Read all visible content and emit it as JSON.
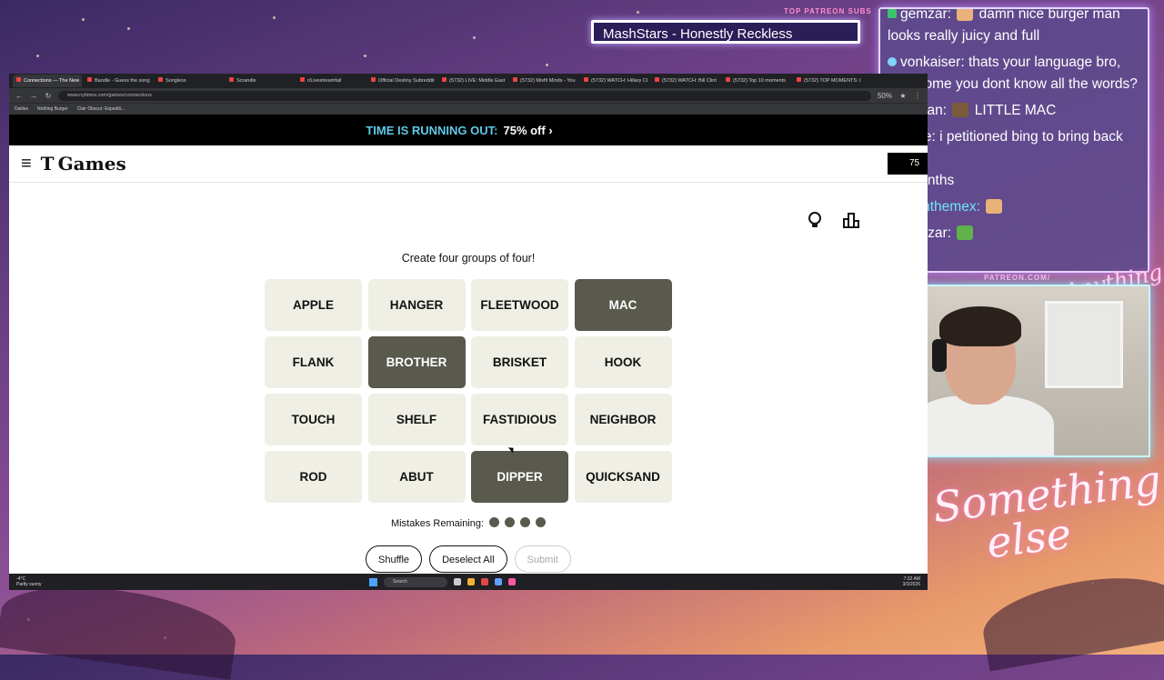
{
  "overlay": {
    "top_patreon_label": "TOP PATREON SUBS",
    "sub_ticker": "MashStars - Honestly Reckless",
    "patreon_url": "PATREON.COM/",
    "brand_signature": "Anything else",
    "brand_big": [
      "Something",
      "else"
    ]
  },
  "chat": {
    "messages": [
      {
        "user": "gemzar:",
        "text": "damn nice burger man looks really juicy and full"
      },
      {
        "user": "vonkaiser:",
        "text": "thats your language bro, how come you dont know all the words?"
      },
      {
        "user": "Tristan:",
        "text": "LITTLE MAC"
      },
      {
        "user": "eerie:",
        "text": "i petitioned bing to bring back"
      },
      {
        "user": "",
        "text": "for months"
      },
      {
        "user": "Joshthemex:",
        "text": ""
      },
      {
        "user": "gemzar:",
        "text": ""
      }
    ],
    "user_colors": {
      "Joshthemex:": "#6fe3ff",
      "default": "#ffffff"
    }
  },
  "browser": {
    "tabs": [
      "Connections — The New",
      "Bandle - Guess the song",
      "Songless",
      "Scrandle",
      "r/Livestreamfail",
      "Official Destiny Subreddit",
      "(5732) LIVE: Middle East",
      "(5732) Misfit Minds - You",
      "(5732) WATCH: Hillary Cl",
      "(5732) WATCH: Bill Clint",
      "(5732) Top 10 moments",
      "(5732) TOP MOMENTS: I"
    ],
    "active_tab_index": 0,
    "url": "www.nytimes.com/games/connections",
    "zoom": "50%",
    "bookmarks": [
      "Dailies",
      "Nothing Burger",
      "Clair Obscur: Expediti..."
    ]
  },
  "promo": {
    "highlight": "TIME IS RUNNING OUT:",
    "offer": "75% off"
  },
  "header": {
    "logo_t": "T",
    "logo_text": "Games",
    "subscribe_fragment": "75"
  },
  "game": {
    "instructions": "Create four groups of four!",
    "tiles": [
      {
        "word": "APPLE",
        "selected": false
      },
      {
        "word": "HANGER",
        "selected": false
      },
      {
        "word": "FLEETWOOD",
        "selected": false
      },
      {
        "word": "MAC",
        "selected": true
      },
      {
        "word": "FLANK",
        "selected": false
      },
      {
        "word": "BROTHER",
        "selected": true
      },
      {
        "word": "BRISKET",
        "selected": false
      },
      {
        "word": "HOOK",
        "selected": false
      },
      {
        "word": "TOUCH",
        "selected": false
      },
      {
        "word": "SHELF",
        "selected": false
      },
      {
        "word": "FASTIDIOUS",
        "selected": false
      },
      {
        "word": "NEIGHBOR",
        "selected": false
      },
      {
        "word": "ROD",
        "selected": false
      },
      {
        "word": "ABUT",
        "selected": false
      },
      {
        "word": "DIPPER",
        "selected": true
      },
      {
        "word": "QUICKSAND",
        "selected": false
      }
    ],
    "mistakes_label": "Mistakes Remaining:",
    "mistakes_remaining": 4,
    "buttons": {
      "shuffle": "Shuffle",
      "deselect": "Deselect All",
      "submit": "Submit"
    }
  },
  "taskbar": {
    "weather_temp": "-4°C",
    "weather_desc": "Partly sunny",
    "search_placeholder": "Search",
    "time": "7:32 AM",
    "date": "3/3/2026"
  },
  "colors": {
    "selected_tile": "#5a594e",
    "tile": "#efefe6",
    "promo_accent": "#5fc9e8"
  }
}
